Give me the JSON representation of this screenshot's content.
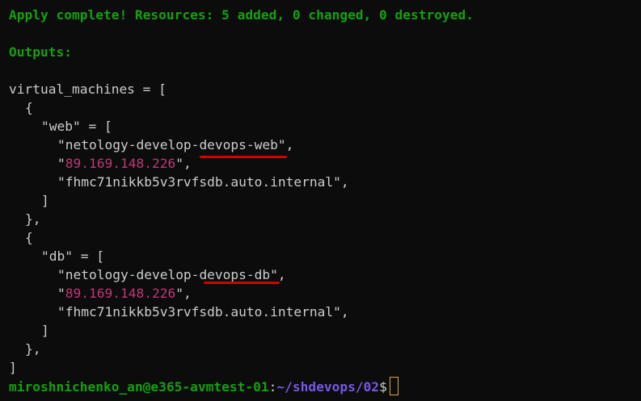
{
  "status_line": "Apply complete! Resources: 5 added, 0 changed, 0 destroyed.",
  "outputs_label": "Outputs:",
  "vm_open": "virtual_machines = [",
  "brace_open": "{",
  "brace_close": "},",
  "bracket_close": "]",
  "list_close": "]",
  "quote": "\"",
  "comma": ",",
  "web": {
    "key_line": "\"web\" = [",
    "name_prefix": "netology-develop-",
    "name_highlight": "devops-web",
    "ip": "89.169.148.226",
    "fqdn_line": "\"fhmc71nikkb5v3rvfsdb.auto.internal\","
  },
  "db": {
    "key_line": "\"db\" = [",
    "name_prefix": "netology-develop-",
    "name_highlight": "devops-db",
    "ip": "89.169.148.226",
    "fqdn_line": "\"fhmc71nikkb5v3rvfsdb.auto.internal\","
  },
  "prompt": {
    "user_host": "miroshnichenko_an@e365-avmtest-01",
    "separator": ":",
    "path": "~/shdevops/02",
    "symbol": "$"
  },
  "colors": {
    "background": "#0c0c0c",
    "text": "#cccccc",
    "green": "#13a10e",
    "magenta": "#c0357a",
    "path_purple": "#7658e3",
    "underline_red": "#d40000",
    "cursor": "#d6a83a"
  }
}
